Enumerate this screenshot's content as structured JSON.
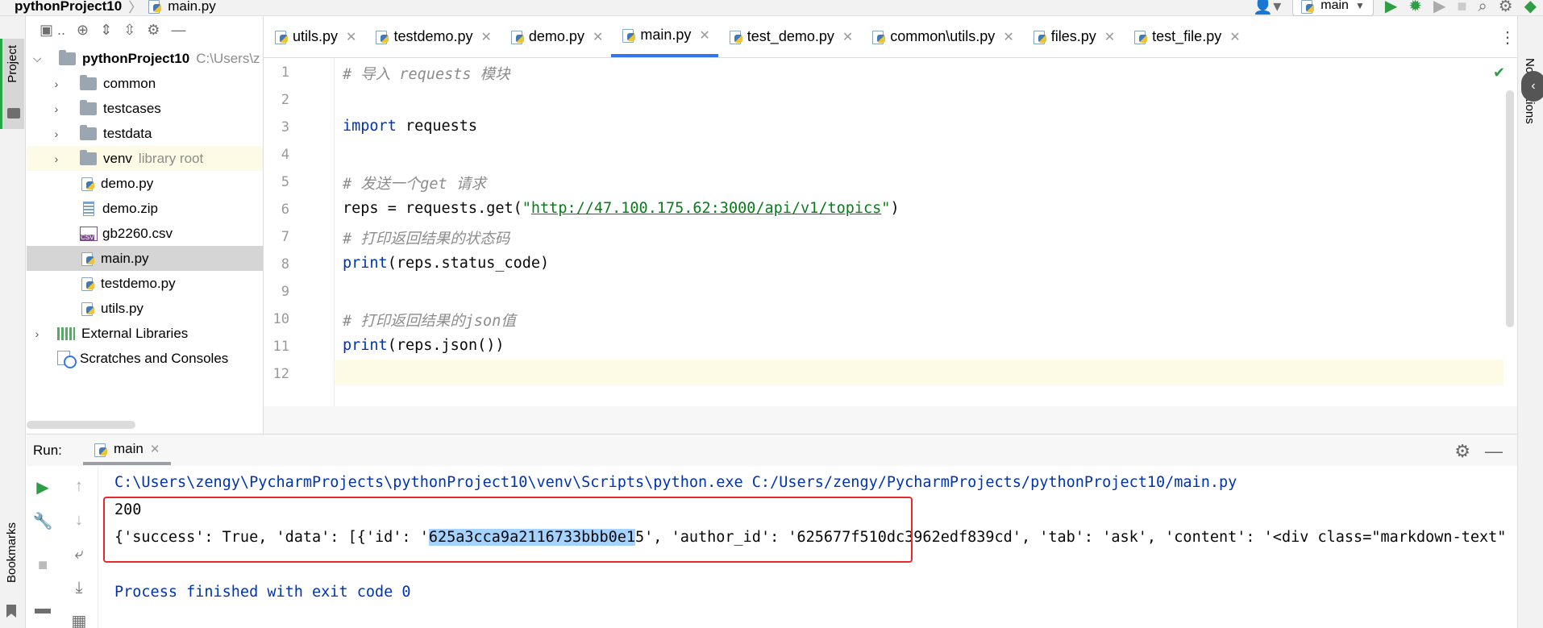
{
  "breadcrumb": {
    "project": "pythonProject10",
    "file": "main.py"
  },
  "toolbar": {
    "run_config": "main"
  },
  "left_stripe": {
    "project": "Project",
    "bookmarks": "Bookmarks"
  },
  "right_stripe": {
    "notifications": "Notifications"
  },
  "project_tree": {
    "root": {
      "name": "pythonProject10",
      "path": "C:\\Users\\z"
    },
    "items": [
      {
        "name": "common",
        "extra": ""
      },
      {
        "name": "testcases",
        "extra": ""
      },
      {
        "name": "testdata",
        "extra": ""
      },
      {
        "name": "venv",
        "extra": "library root"
      },
      {
        "name": "demo.py"
      },
      {
        "name": "demo.zip"
      },
      {
        "name": "gb2260.csv"
      },
      {
        "name": "main.py"
      },
      {
        "name": "testdemo.py"
      },
      {
        "name": "utils.py"
      }
    ],
    "external_libraries": "External Libraries",
    "scratches": "Scratches and Consoles"
  },
  "tabs": [
    {
      "label": "utils.py"
    },
    {
      "label": "testdemo.py"
    },
    {
      "label": "demo.py"
    },
    {
      "label": "main.py",
      "active": true
    },
    {
      "label": "test_demo.py"
    },
    {
      "label": "common\\utils.py"
    },
    {
      "label": "files.py"
    },
    {
      "label": "test_file.py"
    }
  ],
  "editor": {
    "line_numbers": [
      "1",
      "2",
      "3",
      "4",
      "5",
      "6",
      "7",
      "8",
      "9",
      "10",
      "11",
      "12"
    ],
    "code": {
      "l1_comment": "# 导入 requests 模块",
      "l3_kw": "import",
      "l3_rest": " requests",
      "l5_comment": "# 发送一个get 请求",
      "l6_a": "reps = requests.get(",
      "l6_q1": "\"",
      "l6_url": "http://47.100.175.62:3000/api/v1/topics",
      "l6_q2": "\"",
      "l6_b": ")",
      "l7_comment": "# 打印返回结果的状态码",
      "l8_fn": "print",
      "l8_rest": "(reps.status_code)",
      "l10_comment": "# 打印返回结果的json值",
      "l11_fn": "print",
      "l11_rest": "(reps.json())"
    }
  },
  "run_panel": {
    "label": "Run:",
    "tab": "main",
    "console": {
      "command": "C:\\Users\\zengy\\PycharmProjects\\pythonProject10\\venv\\Scripts\\python.exe C:/Users/zengy/PycharmProjects/pythonProject10/main.py",
      "status_code": "200",
      "json_prefix": "{'success': True, 'data': [{'id': '",
      "json_selected": "625a3cca9a2116733bbb0e1",
      "json_suffix": "5', 'author_id': '625677f510dc3962edf839cd', 'tab': 'ask', 'content': '<div class=\"markdown-text\"",
      "exit": "Process finished with exit code 0"
    }
  },
  "colors": {
    "accent": "#3574f0",
    "highlight_box": "#e8282b",
    "selection": "#a6d2ff",
    "run_green": "#2e9e45"
  }
}
